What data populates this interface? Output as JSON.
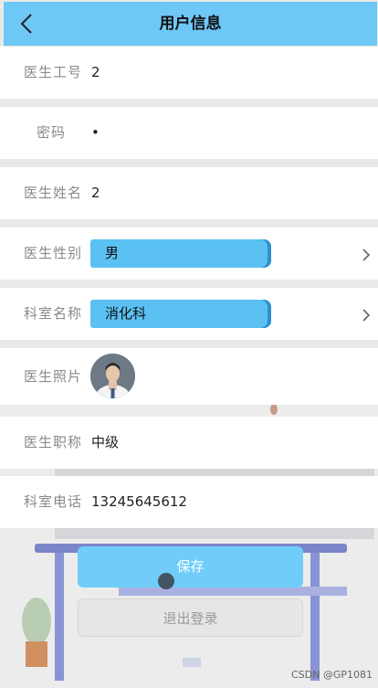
{
  "header": {
    "title": "用户信息",
    "back_icon": "chevron-left-icon"
  },
  "fields": {
    "doctor_id": {
      "label": "医生工号",
      "value": "2"
    },
    "password": {
      "label": "密码",
      "value": "•"
    },
    "doctor_name": {
      "label": "医生姓名",
      "value": "2"
    },
    "gender": {
      "label": "医生性别",
      "value": "男"
    },
    "department": {
      "label": "科室名称",
      "value": "消化科"
    },
    "photo": {
      "label": "医生照片"
    },
    "title": {
      "label": "医生职称",
      "value": "中级"
    },
    "phone": {
      "label": "科室电话",
      "value": "13245645612"
    }
  },
  "buttons": {
    "save": "保存",
    "logout": "退出登录"
  },
  "watermark": "CSDN @GP1081",
  "colors": {
    "accent": "#6ec8f7",
    "pill": "#5bc1f3",
    "pill_edge": "#2d8fd0"
  }
}
